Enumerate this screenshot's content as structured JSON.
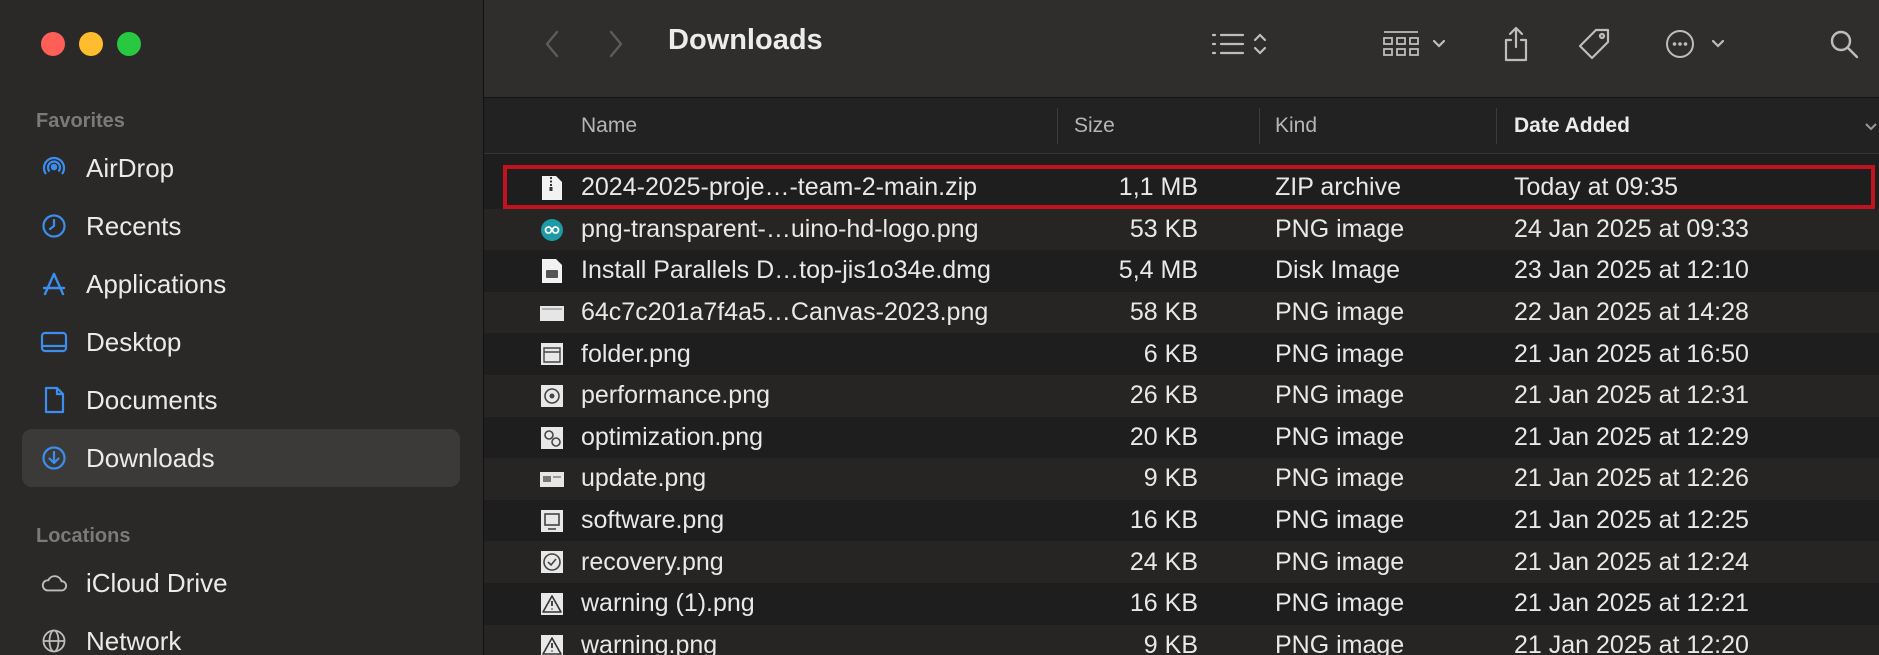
{
  "window": {
    "traffic_lights": {
      "close": "#ff5f57",
      "minimize": "#febc2e",
      "zoom": "#28c840"
    }
  },
  "sidebar": {
    "favorites_label": "Favorites",
    "favorites": [
      {
        "label": "AirDrop",
        "icon": "airdrop-icon"
      },
      {
        "label": "Recents",
        "icon": "clock-icon"
      },
      {
        "label": "Applications",
        "icon": "applications-icon"
      },
      {
        "label": "Desktop",
        "icon": "desktop-icon"
      },
      {
        "label": "Documents",
        "icon": "document-icon"
      },
      {
        "label": "Downloads",
        "icon": "download-icon",
        "selected": true
      }
    ],
    "locations_label": "Locations",
    "locations": [
      {
        "label": "iCloud Drive",
        "icon": "cloud-icon"
      },
      {
        "label": "Network",
        "icon": "network-icon"
      }
    ],
    "accent": "#3b8ef0"
  },
  "toolbar": {
    "title": "Downloads",
    "icons": [
      "back-icon",
      "forward-icon",
      "list-view-icon",
      "grid-view-icon",
      "share-icon",
      "tag-icon",
      "more-icon",
      "search-icon"
    ]
  },
  "columns": {
    "name": "Name",
    "size": "Size",
    "kind": "Kind",
    "date": "Date Added"
  },
  "files": [
    {
      "name": "2024-2025-proje…-team-2-main.zip",
      "size": "1,1 MB",
      "kind": "ZIP archive",
      "date": "Today at 09:35",
      "icon": "zip-icon"
    },
    {
      "name": "png-transparent-…uino-hd-logo.png",
      "size": "53 KB",
      "kind": "PNG image",
      "date": "24 Jan 2025 at 09:33",
      "icon": "arduino-icon"
    },
    {
      "name": "Install Parallels D…top-jis1o34e.dmg",
      "size": "5,4 MB",
      "kind": "Disk Image",
      "date": "23 Jan 2025 at 12:10",
      "icon": "disk-image-icon"
    },
    {
      "name": "64c7c201a7f4a5…Canvas-2023.png",
      "size": "58 KB",
      "kind": "PNG image",
      "date": "22 Jan 2025 at 14:28",
      "icon": "image-icon"
    },
    {
      "name": "folder.png",
      "size": "6 KB",
      "kind": "PNG image",
      "date": "21 Jan 2025 at 16:50",
      "icon": "image-icon"
    },
    {
      "name": "performance.png",
      "size": "26 KB",
      "kind": "PNG image",
      "date": "21 Jan 2025 at 12:31",
      "icon": "image-icon"
    },
    {
      "name": "optimization.png",
      "size": "20 KB",
      "kind": "PNG image",
      "date": "21 Jan 2025 at 12:29",
      "icon": "image-icon"
    },
    {
      "name": "update.png",
      "size": "9 KB",
      "kind": "PNG image",
      "date": "21 Jan 2025 at 12:26",
      "icon": "image-icon"
    },
    {
      "name": "software.png",
      "size": "16 KB",
      "kind": "PNG image",
      "date": "21 Jan 2025 at 12:25",
      "icon": "image-icon"
    },
    {
      "name": "recovery.png",
      "size": "24 KB",
      "kind": "PNG image",
      "date": "21 Jan 2025 at 12:24",
      "icon": "image-icon"
    },
    {
      "name": "warning (1).png",
      "size": "16 KB",
      "kind": "PNG image",
      "date": "21 Jan 2025 at 12:21",
      "icon": "warning-icon"
    },
    {
      "name": "warning.png",
      "size": "9 KB",
      "kind": "PNG image",
      "date": "21 Jan 2025 at 12:20",
      "icon": "warning-icon"
    }
  ],
  "highlight_color": "#c1121f"
}
